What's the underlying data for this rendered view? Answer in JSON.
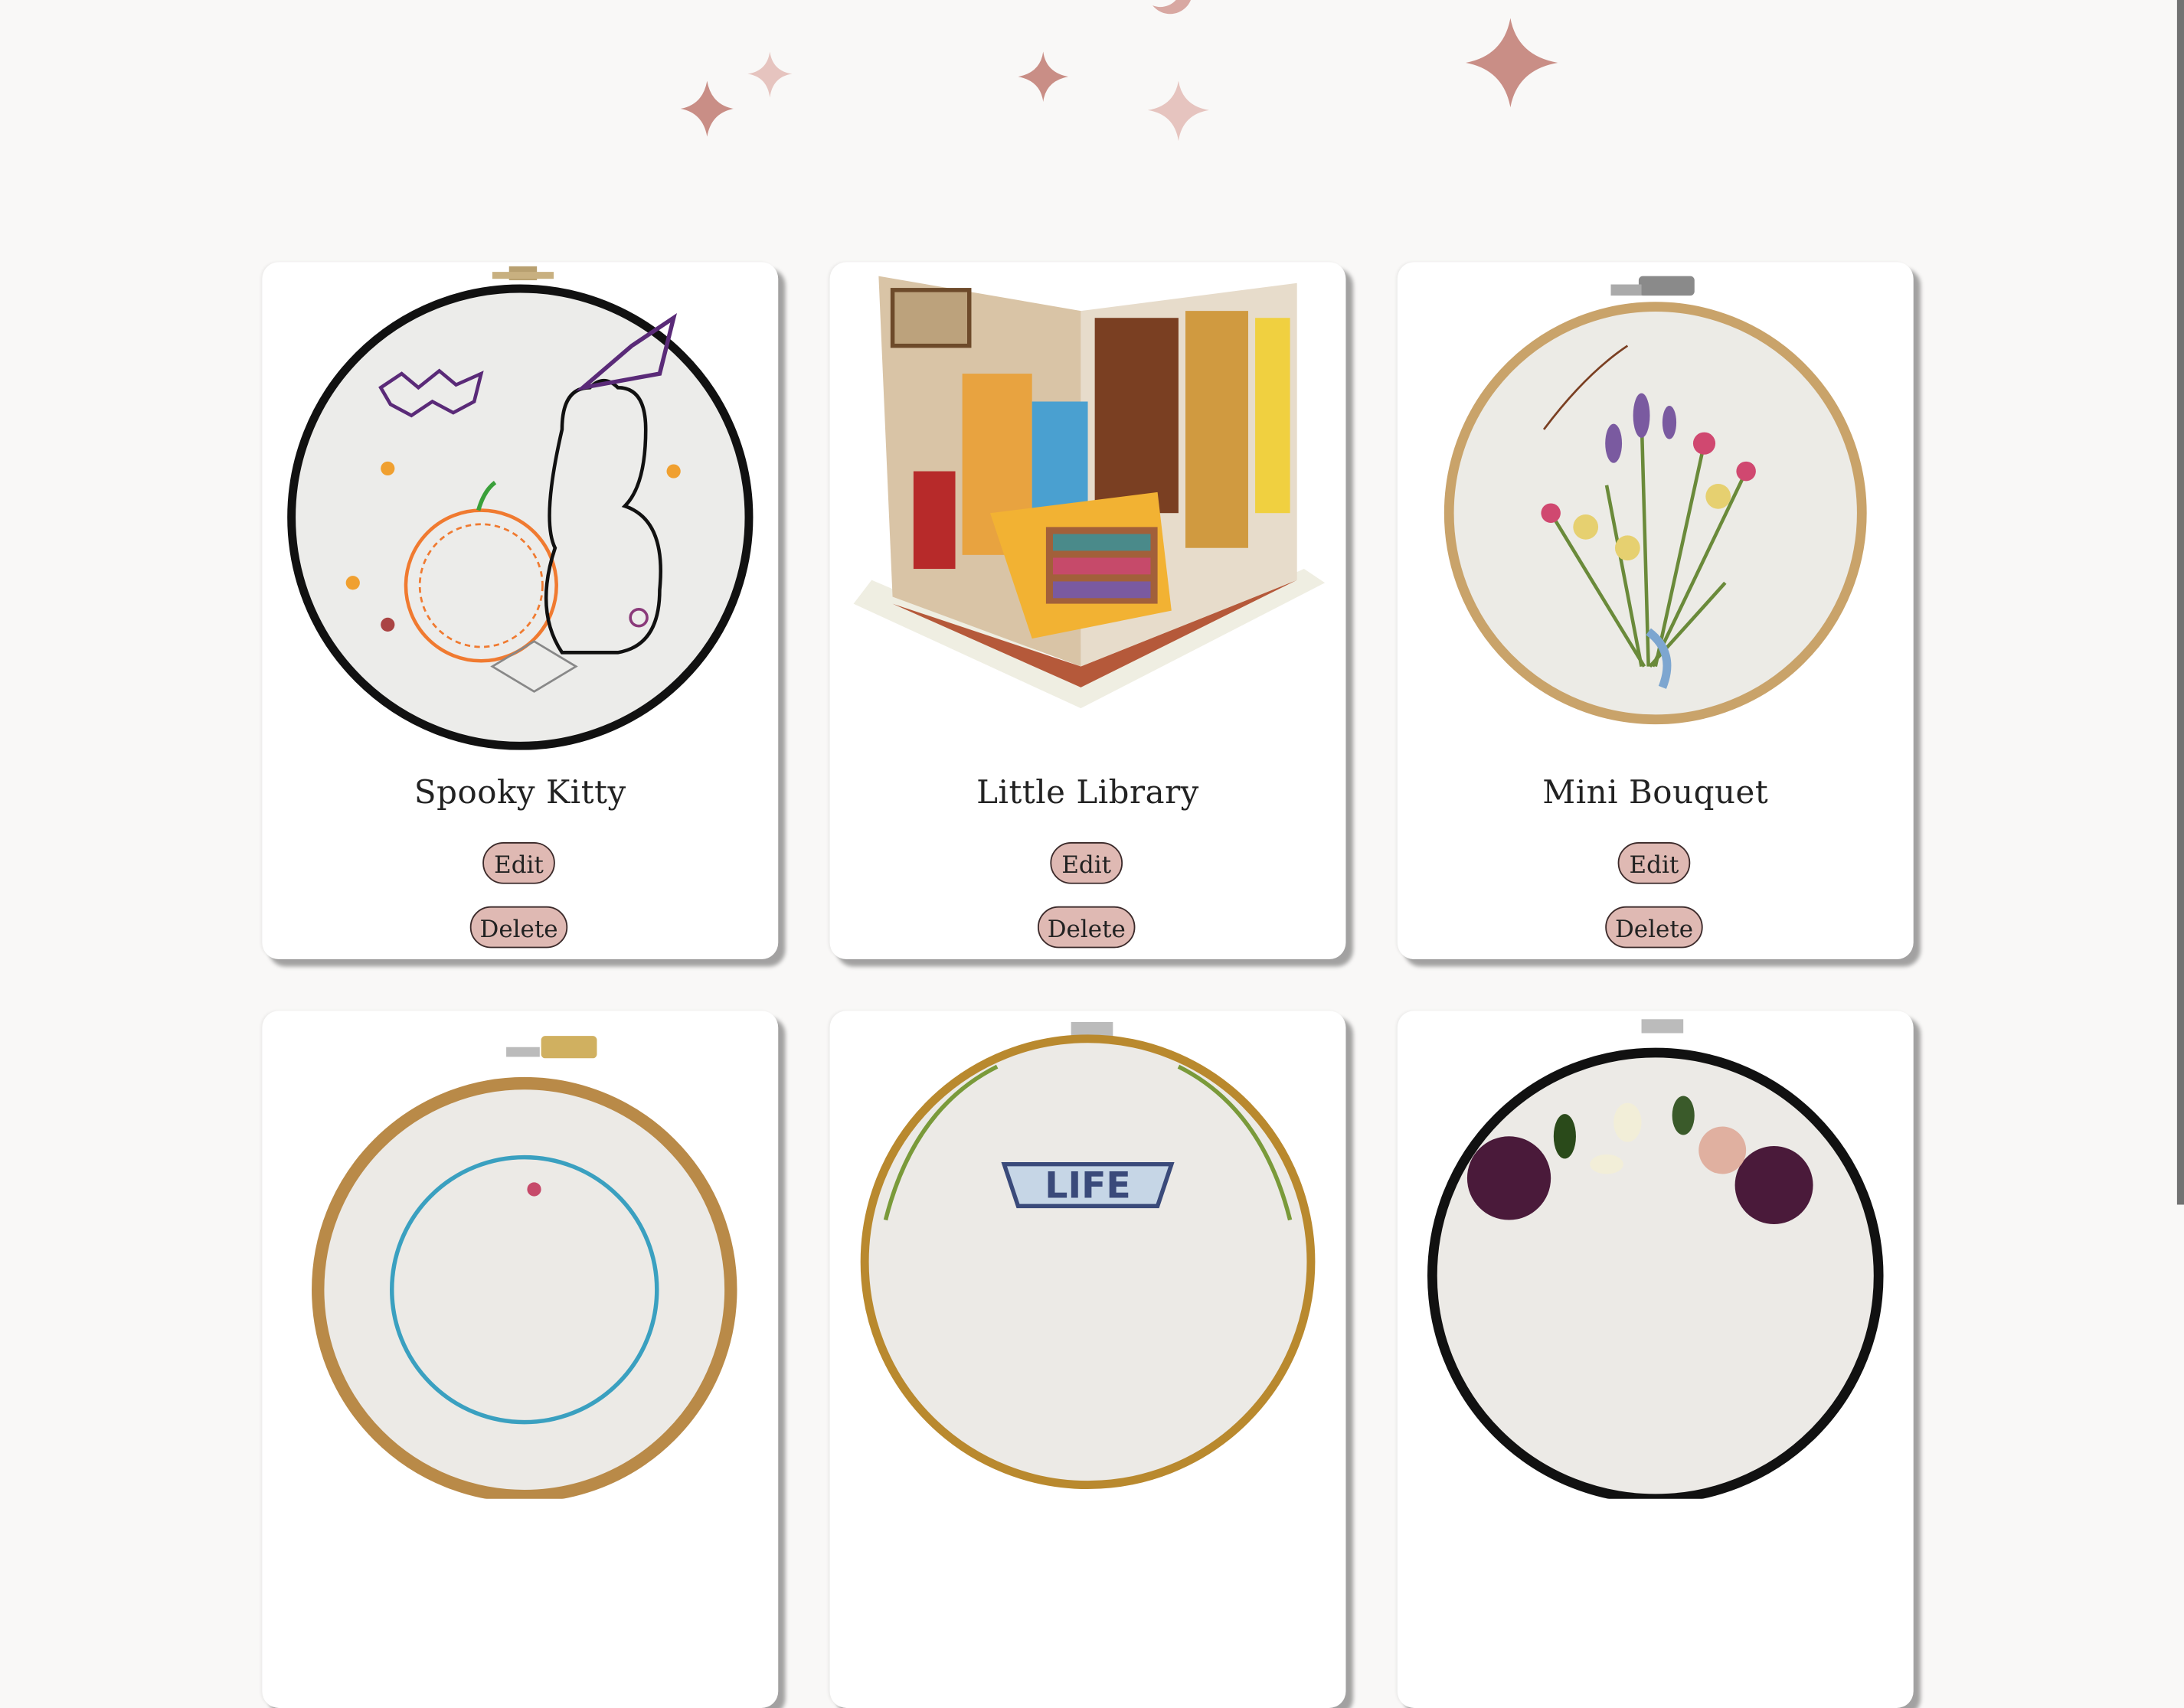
{
  "colors": {
    "background": "#f9f8f7",
    "accent_button": "#dfb9b3",
    "sparkle": "#d29a92"
  },
  "gallery": {
    "cards": [
      {
        "title": "Spooky Kitty",
        "edit_label": "Edit",
        "delete_label": "Delete"
      },
      {
        "title": "Little Library",
        "edit_label": "Edit",
        "delete_label": "Delete"
      },
      {
        "title": "Mini Bouquet",
        "edit_label": "Edit",
        "delete_label": "Delete"
      },
      {
        "title": "",
        "edit_label": "",
        "delete_label": ""
      },
      {
        "title": "",
        "edit_label": "",
        "delete_label": ""
      },
      {
        "title": "",
        "edit_label": "",
        "delete_label": ""
      }
    ],
    "row2_art_text": "LIFE"
  },
  "icons": [
    "sparkle-icon",
    "moon-icon",
    "edit-button",
    "delete-button"
  ]
}
